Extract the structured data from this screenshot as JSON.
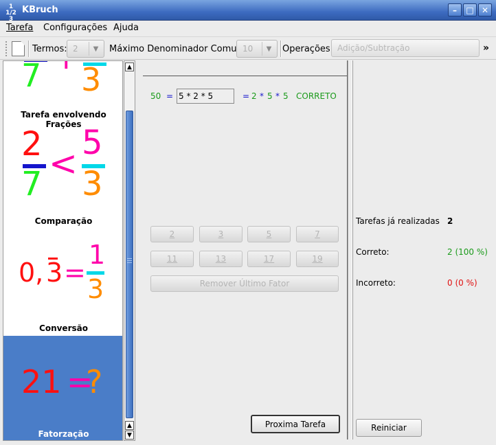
{
  "window": {
    "title": "KBruch",
    "icon_text": "1 1/2 3"
  },
  "menu": {
    "items": [
      "Tarefa",
      "Configurações",
      "Ajuda"
    ]
  },
  "toolbar": {
    "terms_label": "Termos:",
    "terms_value": "2",
    "mcd_label": "Máximo Denominador Comum",
    "mcd_value": "10",
    "ops_label": "Operações:",
    "ops_value": "Adição/Subtração",
    "more": "»"
  },
  "tasks": [
    {
      "label": "Tarefa envolvendo Frações",
      "selected": false,
      "glyph_a": "7",
      "glyph_op": "+",
      "glyph_b": "3"
    },
    {
      "label": "Comparação",
      "selected": false,
      "num_a": "2",
      "den_a": "7",
      "glyph_op": "<",
      "num_b": "5",
      "den_b": "3"
    },
    {
      "label": "Conversão",
      "selected": false,
      "dec_a": "0,",
      "dec_b": "3",
      "glyph_eq": "=",
      "num": "1",
      "den": "3"
    },
    {
      "label": "Fatorzação",
      "selected": true,
      "num": "21",
      "glyph_eq": "=",
      "glyph_q": "?"
    }
  ],
  "exercise": {
    "number": "50",
    "eq1": "=",
    "input_value": "5 * 2 * 5",
    "eq2": "=",
    "result_parts": [
      "2",
      "*",
      "5",
      "*",
      "5"
    ],
    "status": "CORRETO",
    "factor_buttons": [
      "2",
      "3",
      "5",
      "7",
      "11",
      "13",
      "17",
      "19"
    ],
    "remove_label": "Remover Último Fator",
    "next_label": "Proxima Tarefa"
  },
  "stats": {
    "done_label": "Tarefas já realizadas",
    "done_value": "2",
    "correct_label": "Correto:",
    "correct_value": "2 (100 %)",
    "incorrect_label": "Incorreto:",
    "incorrect_value": "0 (0 %)",
    "reset_label": "Reiniciar"
  },
  "colors": {
    "green": "#1a9a1a",
    "blue": "#1515cc",
    "red": "#e01010",
    "pink": "#ff00aa",
    "orange": "#ff8c00",
    "cyan": "#00d8e8",
    "selection": "#4a7dc8"
  }
}
